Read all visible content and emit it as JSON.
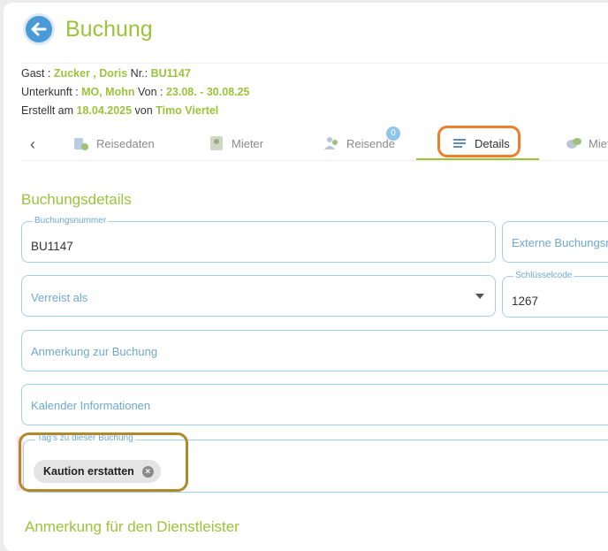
{
  "header": {
    "title": "Buchung"
  },
  "booking_info": {
    "guest_label": "Gast : ",
    "guest_name": "Zucker , Doris",
    "nr_label": " Nr.: ",
    "nr_value": "BU1147",
    "unit_label": "Unterkunft : ",
    "unit_value": "MO, Mohn",
    "from_label": " Von : ",
    "from_value": "23.08. - 30.08.25",
    "created_label": "Erstellt am ",
    "created_date": "18.04.2025",
    "by_label": " von ",
    "by_value": "Timo Viertel"
  },
  "tabs": {
    "items": [
      {
        "label": "Reisedaten",
        "icon": "travel-data-icon"
      },
      {
        "label": "Mieter",
        "icon": "tenant-icon"
      },
      {
        "label": "Reisende",
        "icon": "travelers-icon",
        "badge": "0"
      },
      {
        "label": "Details",
        "icon": "details-icon",
        "active": true
      },
      {
        "label": "Miet",
        "icon": "rent-icon"
      }
    ]
  },
  "section": {
    "title": "Buchungsdetails",
    "next_title": "Anmerkung für den Dienstleister"
  },
  "fields": {
    "booking_number": {
      "label": "Buchungsnummer",
      "value": "BU1147"
    },
    "external_booking_number": {
      "placeholder": "Externe Buchungsnr"
    },
    "travel_as": {
      "placeholder": "Verreist als"
    },
    "key_code": {
      "label": "Schlüsselcode",
      "value": "1267"
    },
    "booking_note": {
      "placeholder": "Anmerkung zur Buchung"
    },
    "calendar_info": {
      "placeholder": "Kalender Informationen"
    },
    "tags": {
      "label": "Tag's zu dieser Buchung",
      "chip": "Kaution erstatten"
    }
  },
  "colors": {
    "accent": "#9cc33a",
    "field_border": "#a5cfe8",
    "highlight_orange": "#ef7d2c",
    "highlight_gold": "#b08a2a"
  }
}
